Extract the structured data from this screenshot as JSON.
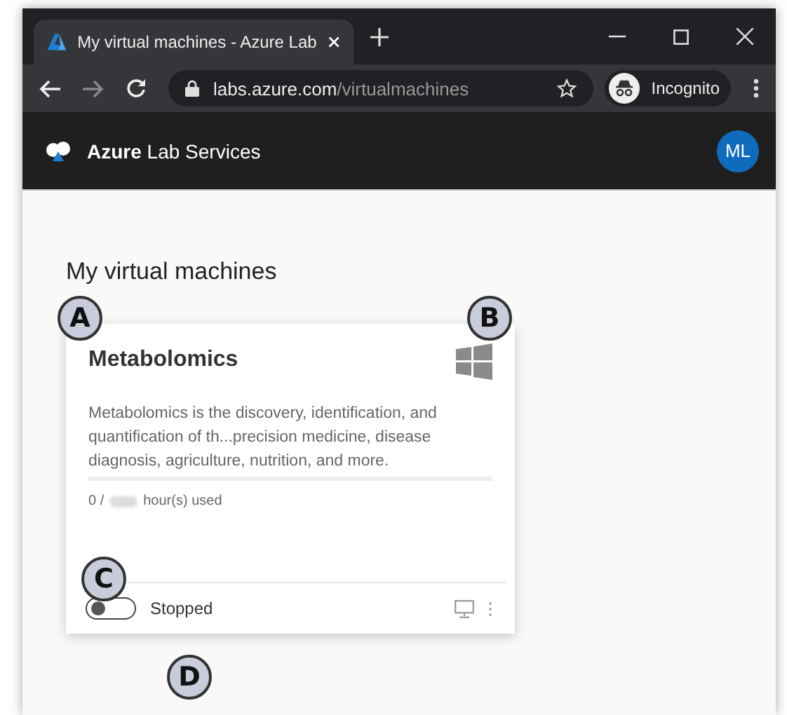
{
  "browser": {
    "tab_title": "My virtual machines - Azure Lab",
    "url_host": "labs.azure.com",
    "url_path": "/virtualmachines",
    "profile_label": "Incognito"
  },
  "app_header": {
    "brand": "**Azure** Lab Services",
    "avatar": "ML"
  },
  "heading": "My virtual machines",
  "card": {
    "title": "Metabolomics",
    "description": "Metabolomics is the discovery, identification, and quantification of th...precision medicine, disease diagnosis, agriculture, nutrition, and more.",
    "usage": {
      "used": "0 /",
      "unit": "hour(s) used"
    },
    "toggle": {
      "on": false
    },
    "status": "Stopped"
  },
  "callouts": [
    "A",
    "B",
    "C",
    "D"
  ]
}
